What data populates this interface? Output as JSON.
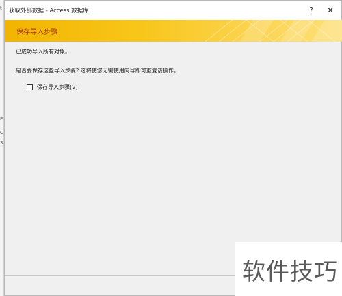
{
  "background_strip": {
    "chars": [
      "t",
      "E",
      "C",
      "3"
    ]
  },
  "window": {
    "title": "获取外部数据 - Access 数据库",
    "help_label": "?",
    "close_label": "✕"
  },
  "banner": {
    "title": "保存导入步骤",
    "color": "#f7c21a"
  },
  "content": {
    "message1": "已成功导入所有对象。",
    "message2": "是否要保存这些导入步骤? 这将使您无需使用向导即可重复该操作。",
    "save_checkbox": {
      "label": "保存导入步骤",
      "access_key": "(V)",
      "checked": false
    }
  },
  "watermark": {
    "text": "软件技巧"
  }
}
